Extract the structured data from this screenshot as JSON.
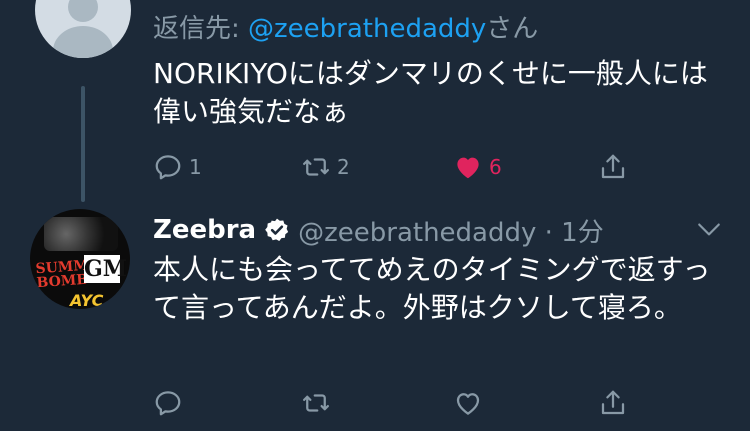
{
  "reply_tweet": {
    "reply_prefix": "返信先: ",
    "reply_handle": "@zeebrathedaddy",
    "reply_suffix": "さん",
    "text": "NORIKIYOにはダンマリのくせに一般人には偉い強気だなぁ",
    "replies": "1",
    "retweets": "2",
    "likes": "6",
    "liked": true
  },
  "main_tweet": {
    "name": "Zeebra",
    "handle_time": "@zeebrathedaddy · 1分",
    "text": "本人にも会っててめえのタイミングで返すって言ってあんだよ。外野はクソして寝ろ。",
    "avatar_texts": {
      "summer_bomb": "SUMMER BOMB",
      "gm": "GM",
      "ayc": "AYC"
    }
  },
  "colors": {
    "background": "#1c2938",
    "muted": "#8899a6",
    "link": "#1da1f2",
    "like": "#e0245e"
  }
}
